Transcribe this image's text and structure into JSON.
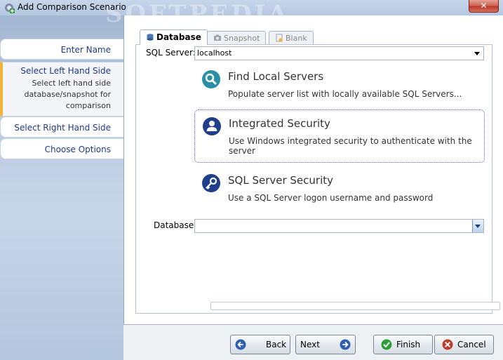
{
  "window": {
    "title": "Add Comparison Scenario",
    "close_label": "✕",
    "watermark": "SOFTPEDIA"
  },
  "steps": [
    {
      "label": "Enter Name"
    },
    {
      "label": "Select Left Hand Side",
      "description_lines": [
        "Select left hand side",
        "database/snapshot for",
        "comparison"
      ]
    },
    {
      "label": "Select Right Hand Side"
    },
    {
      "label": "Choose Options"
    }
  ],
  "tabs": [
    {
      "label": "Database",
      "icon": "database-icon",
      "active": true
    },
    {
      "label": "Snapshot",
      "icon": "camera-icon",
      "active": false
    },
    {
      "label": "Blank",
      "icon": "blank-icon",
      "active": false
    }
  ],
  "form": {
    "sql_server_label": "SQL Server:",
    "sql_server_value": "localhost",
    "database_label": "Database:",
    "database_value": ""
  },
  "options": [
    {
      "title": "Find Local Servers",
      "description": "Populate server list with locally available SQL Servers...",
      "icon": "search-icon",
      "icon_color": "#2a8fa6"
    },
    {
      "title": "Integrated Security",
      "description": "Use Windows integrated security to authenticate with the server",
      "icon": "user-icon",
      "icon_color": "#1f3e8c"
    },
    {
      "title": "SQL Server Security",
      "description": "Use a SQL Server logon username and password",
      "icon": "key-icon",
      "icon_color": "#1f3e8c"
    }
  ],
  "footer": {
    "back_label": "Back",
    "next_label": "Next",
    "finish_label": "Finish",
    "cancel_label": "Cancel"
  },
  "colors": {
    "accent": "#f0b43c",
    "link": "#1e3a8a",
    "finish": "#2e9e3a",
    "cancel": "#c0392b",
    "nav": "#2f5fb3"
  }
}
